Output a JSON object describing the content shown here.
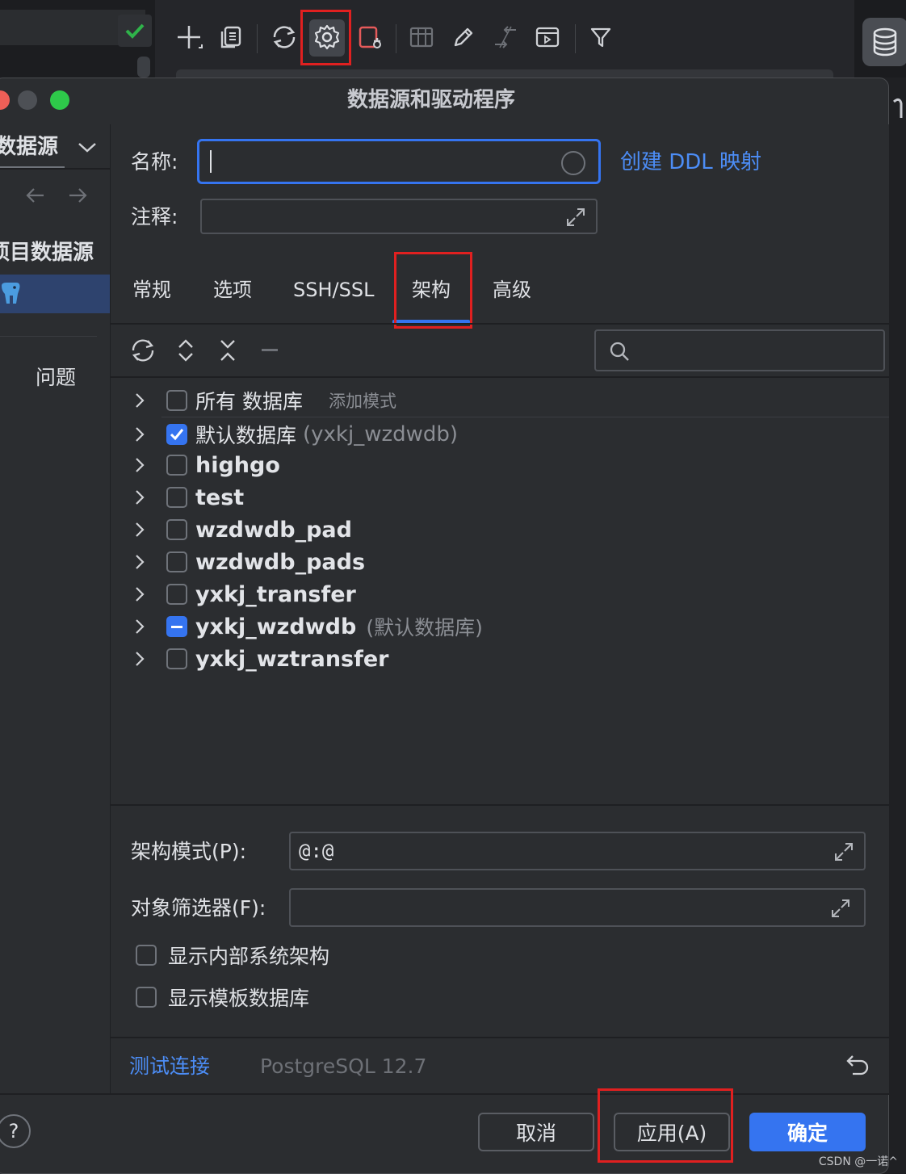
{
  "dialog": {
    "title": "数据源和驱动程序"
  },
  "sidebar": {
    "header": "数据源",
    "section_label": "项目数据源",
    "problems": "问题"
  },
  "form": {
    "name_label": "名称:",
    "name_value": "",
    "comment_label": "注释:",
    "comment_value": "",
    "ddl_link": "创建 DDL 映射"
  },
  "tabs": [
    {
      "label": "常规"
    },
    {
      "label": "选项"
    },
    {
      "label": "SSH/SSL"
    },
    {
      "label": "架构",
      "active": true
    },
    {
      "label": "高级"
    }
  ],
  "schema_search": {
    "placeholder": ""
  },
  "tree": [
    {
      "name": "所有 数据库",
      "hint": "添加模式",
      "state": "unchecked",
      "style": "header"
    },
    {
      "name": "默认数据库",
      "hint": "(yxkj_wzdwdb)",
      "state": "checked"
    },
    {
      "name": "highgo",
      "hint": "",
      "state": "unchecked"
    },
    {
      "name": "test",
      "hint": "",
      "state": "unchecked"
    },
    {
      "name": "wzdwdb_pad",
      "hint": "",
      "state": "unchecked"
    },
    {
      "name": "wzdwdb_pads",
      "hint": "",
      "state": "unchecked"
    },
    {
      "name": "yxkj_transfer",
      "hint": "",
      "state": "unchecked"
    },
    {
      "name": "yxkj_wzdwdb",
      "hint": "(默认数据库)",
      "state": "partial"
    },
    {
      "name": "yxkj_wztransfer",
      "hint": "",
      "state": "unchecked"
    }
  ],
  "schema_pattern": {
    "label": "架构模式(P):",
    "value": "@:@"
  },
  "object_filter": {
    "label": "对象筛选器(F):",
    "value": ""
  },
  "options": {
    "show_internal": "显示内部系统架构",
    "show_templates": "显示模板数据库"
  },
  "footer": {
    "test_connection": "测试连接",
    "driver_version": "PostgreSQL 12.7"
  },
  "buttons": {
    "help": "?",
    "cancel": "取消",
    "apply": "应用(A)",
    "ok": "确定"
  },
  "watermark": "CSDN @一诺^",
  "colors": {
    "accent": "#3574f0",
    "highlight_box": "#e02020",
    "check_green": "#2fb34a"
  }
}
